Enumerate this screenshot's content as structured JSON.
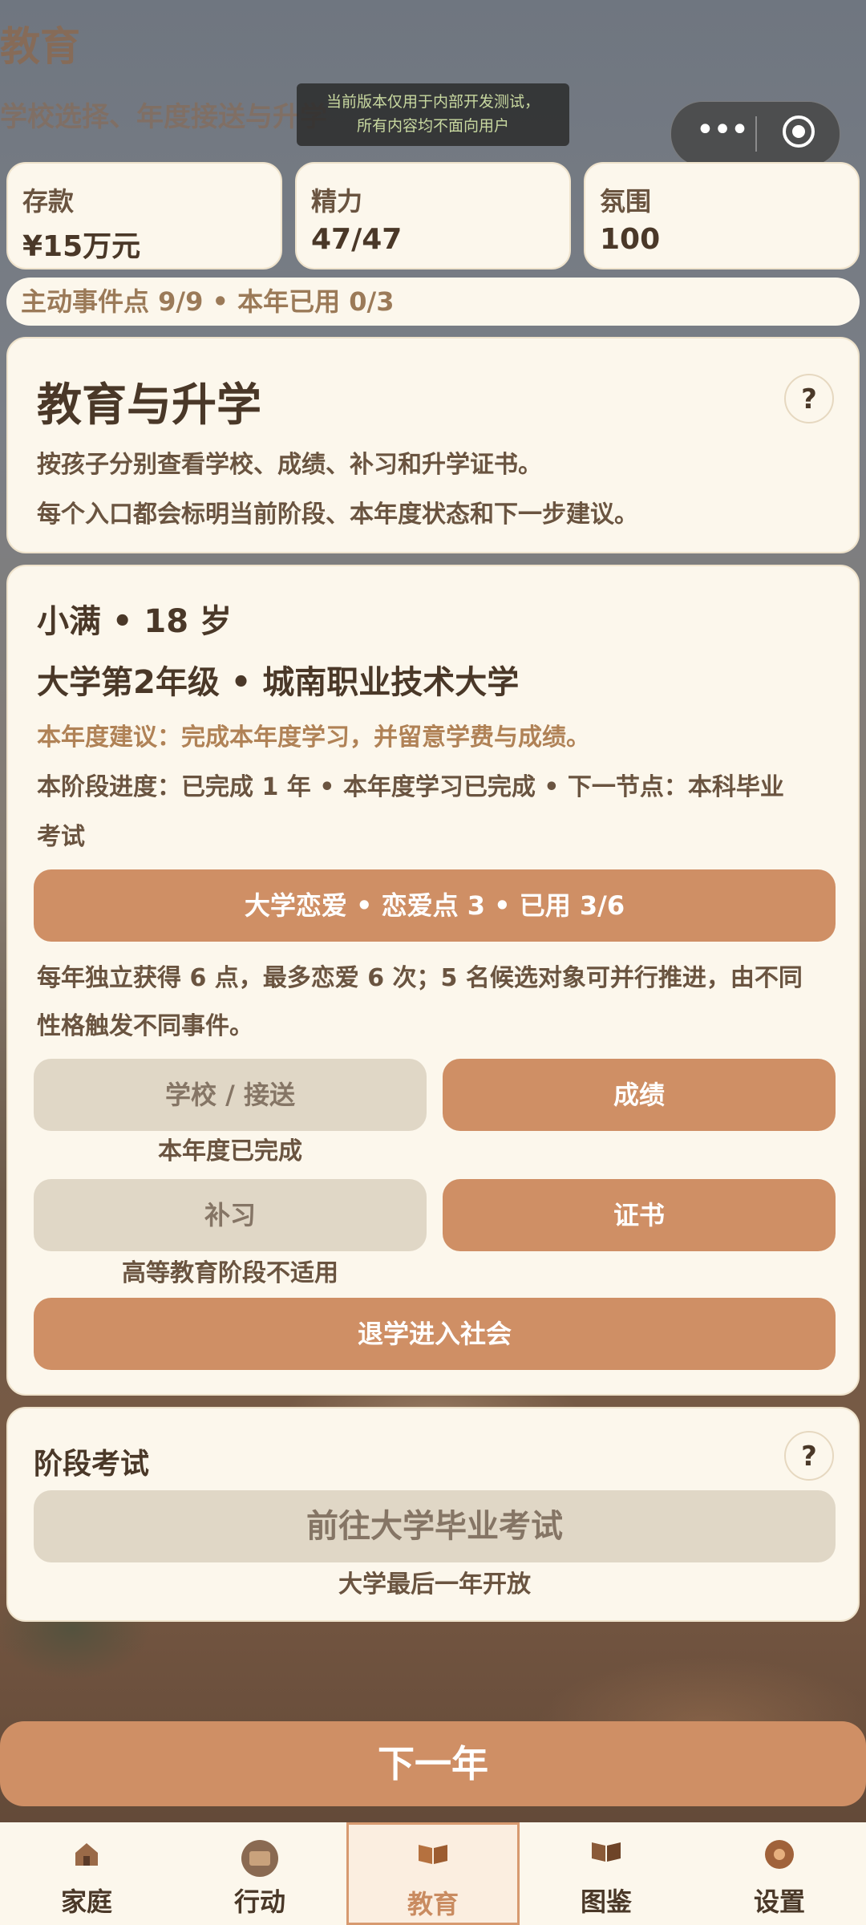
{
  "header": {
    "title": "教育",
    "subtitle": "学校选择、年度接送与升学"
  },
  "dev_notice": {
    "line1": "当前版本仅用于内部开发测试，",
    "line2": "所有内容均不面向用户"
  },
  "capsule": {
    "more": "•••"
  },
  "stats": [
    {
      "label": "存款",
      "value": "¥15万元"
    },
    {
      "label": "精力",
      "value": "47/47"
    },
    {
      "label": "氛围",
      "value": "100"
    }
  ],
  "points_bar": "主动事件点 9/9 • 本年已用 0/3",
  "intro": {
    "title": "教育与升学",
    "help": "?",
    "line1": "按孩子分别查看学校、成绩、补习和升学证书。",
    "line2": "每个入口都会标明当前阶段、本年度状态和下一步建议。"
  },
  "child": {
    "name_age": "小满 • 18 岁",
    "stage": "大学第2年级 • 城南职业技术大学",
    "advice": "本年度建议：完成本年度学习，并留意学费与成绩。",
    "progress_l1": "本阶段进度：已完成 1 年 • 本年度学习已完成 • 下一节点：本科毕业",
    "progress_l2": "考试",
    "love_button": "大学恋爱 • 恋爱点 3 • 已用 3/6",
    "love_desc_l1": "每年独立获得 6 点，最多恋爱 6 次；5 名候选对象可并行推进，由不同",
    "love_desc_l2": "性格触发不同事件。",
    "school_button": "学校 / 接送",
    "school_note": "本年度已完成",
    "grades_button": "成绩",
    "tutoring_button": "补习",
    "tutoring_note": "高等教育阶段不适用",
    "certificate_button": "证书",
    "dropout_button": "退学进入社会"
  },
  "exam": {
    "title": "阶段考试",
    "help": "?",
    "button": "前往大学毕业考试",
    "note": "大学最后一年开放"
  },
  "next_year": "下一年",
  "tabs": [
    {
      "label": "家庭",
      "icon": "house-icon"
    },
    {
      "label": "行动",
      "icon": "action-icon"
    },
    {
      "label": "教育",
      "icon": "book-icon",
      "active": true
    },
    {
      "label": "图鉴",
      "icon": "album-icon"
    },
    {
      "label": "设置",
      "icon": "settings-icon"
    }
  ]
}
